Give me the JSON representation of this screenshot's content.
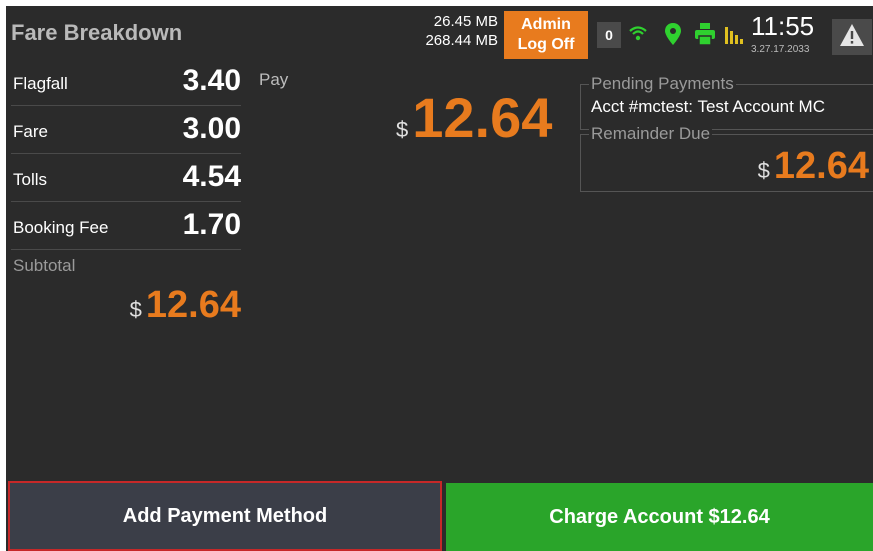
{
  "header": {
    "title": "Fare Breakdown",
    "memory_free": "26.45 MB",
    "memory_total": "268.44 MB",
    "admin_line1": "Admin",
    "admin_line2": "Log Off",
    "badge_count": "0",
    "time": "11:55",
    "date": "3.27.17.2033",
    "icons": [
      "wifi-icon",
      "location-pin-icon",
      "printer-icon",
      "signal-bars-icon",
      "warning-icon"
    ]
  },
  "fare": {
    "items": [
      {
        "label": "Flagfall",
        "value": "3.40"
      },
      {
        "label": "Fare",
        "value": "3.00"
      },
      {
        "label": "Tolls",
        "value": "4.54"
      },
      {
        "label": "Booking Fee",
        "value": "1.70"
      }
    ],
    "subtotal_label": "Subtotal",
    "subtotal_currency": "$",
    "subtotal_value": "12.64"
  },
  "pay": {
    "label": "Pay",
    "currency": "$",
    "value": "12.64"
  },
  "pending": {
    "title": "Pending Payments",
    "text": "Acct #mctest: Test Account MC"
  },
  "remainder": {
    "title": "Remainder Due",
    "currency": "$",
    "value": "12.64"
  },
  "buttons": {
    "add_payment": "Add Payment Method",
    "charge_account": "Charge Account $12.64"
  },
  "colors": {
    "accent_orange": "#e87b1e",
    "charge_green": "#2aa52a",
    "background": "#2b2b2b",
    "selection_red": "#c62828"
  }
}
